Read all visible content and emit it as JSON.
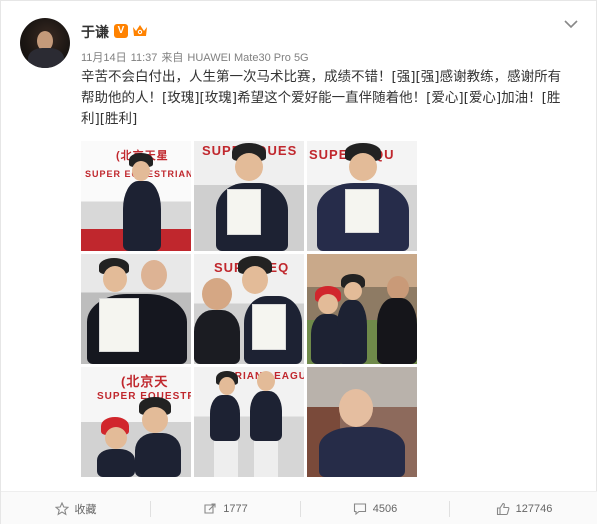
{
  "user": {
    "name": "于谦",
    "verified_badge": "V"
  },
  "meta": {
    "date": "11月14日",
    "time": "11:37",
    "source_prefix": "来自",
    "device": "HUAWEI Mate30 Pro 5G"
  },
  "post": {
    "lines": [
      "辛苦不会白付出，人生第一次马术比赛，成绩不错！[强][强]感谢教练，感谢所有",
      "帮助他的人！[玫瑰][玫瑰]希望这个爱好能一直伴随着他！[爱心][爱心]加油！[胜",
      "利][胜利]"
    ]
  },
  "photos": [
    {
      "banner": "(北京天星",
      "banner_color": "#c0272d"
    },
    {
      "banner": "SUPER QUES",
      "banner_color": "#c0272d"
    },
    {
      "banner": "SUPER EQU",
      "banner_color": "#c0272d"
    },
    {
      "banner": "",
      "banner_color": "#c0272d"
    },
    {
      "banner": "SUPER EQ",
      "banner_color": "#c0272d"
    },
    {
      "banner": "",
      "banner_color": "#c0272d"
    },
    {
      "banner": "(北京天",
      "banner_color": "#c0272d"
    },
    {
      "banner": "STRIAN LEAGU",
      "banner_color": "#c0272d"
    },
    {
      "banner": "",
      "banner_color": "#c0272d"
    }
  ],
  "photo_banner_extra": {
    "p1_sub": "SUPER EQUESTRIAN",
    "p7_sub": "SUPER EQUESTRI"
  },
  "actions": {
    "favorite_label": "收藏",
    "repost_count": "1777",
    "comment_count": "4506",
    "like_count": "127746"
  },
  "colors": {
    "brand_orange": "#ff8200",
    "text_gray": "#808080",
    "banner_red": "#c0272d"
  }
}
